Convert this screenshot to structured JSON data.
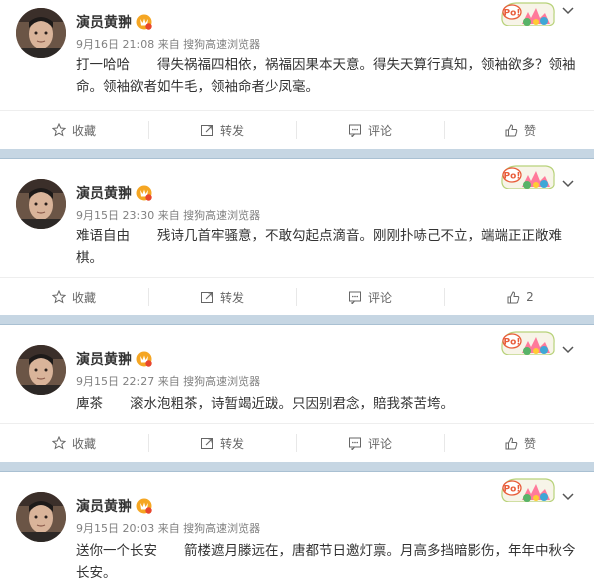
{
  "posts": [
    {
      "author": "演员黄翀",
      "meta": "9月16日 21:08 来自 搜狗高速浏览器",
      "content": "打一哈哈　　得失祸福四相依，祸福因果本天意。得失天算行真知，领袖欲多？领袖命。领袖欲者如牛毛，领袖命者少凤毫。",
      "actions": {
        "favorite": "收藏",
        "repost": "转发",
        "comment": "评论",
        "like": "赞"
      }
    },
    {
      "author": "演员黄翀",
      "meta": "9月15日 23:30 来自 搜狗高速浏览器",
      "content": "难语自由　　残诗几首牢骚意，不敢勾起点滴音。刚刚扑哧己不立，端端正正敞难棋。",
      "actions": {
        "favorite": "收藏",
        "repost": "转发",
        "comment": "评论",
        "like": "2"
      }
    },
    {
      "author": "演员黄翀",
      "meta": "9月15日 22:27 来自 搜狗高速浏览器",
      "content": "庳茶　　滚水泡粗茶，诗暂竭近跋。只因别君念，賠我茶苦垮。",
      "actions": {
        "favorite": "收藏",
        "repost": "转发",
        "comment": "评论",
        "like": "赞"
      }
    },
    {
      "author": "演员黄翀",
      "meta": "9月15日 20:03 来自 搜狗高速浏览器",
      "content": "送你一个长安　　箭楼遮月滕远在，唐都节日邀灯禀。月高多挡暗影伤，年年中秋今长安。"
    }
  ],
  "pill_text": "Po!"
}
